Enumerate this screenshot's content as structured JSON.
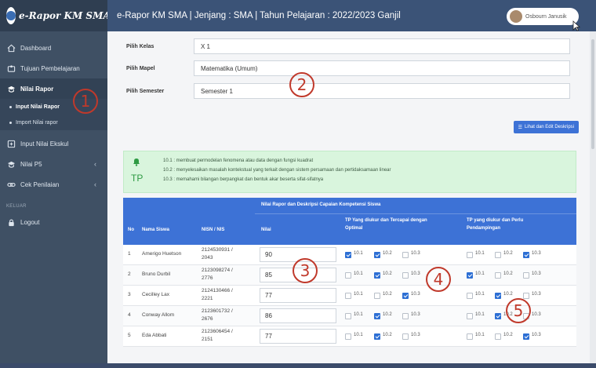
{
  "brand": {
    "name": "e-Rapor KM SMA",
    "collapse_icon": "double-chevron-left-icon"
  },
  "header": {
    "title": "e-Rapor KM SMA | Jenjang : SMA | Tahun Pelajaran : 2022/2023 Ganjil",
    "user_name": "Osbourn Janusik"
  },
  "sidebar": {
    "items": [
      {
        "label": "Dashboard",
        "icon": "home-icon"
      },
      {
        "label": "Tujuan Pembelajaran",
        "icon": "puzzle-icon"
      },
      {
        "label": "Nilai Rapor",
        "icon": "graduation-icon"
      },
      {
        "label": "Input Nilai Ekskul",
        "icon": "square-icon"
      },
      {
        "label": "Nilai P5",
        "icon": "graduation-icon"
      },
      {
        "label": "Cek Penilaian",
        "icon": "link-icon"
      },
      {
        "label": "Logout",
        "icon": "lock-icon"
      }
    ],
    "sub_items": [
      "Input Nilai Rapor",
      "Import Nilai rapor"
    ],
    "section_label": "KELUAR"
  },
  "form": {
    "kelas_label": "Pilih Kelas",
    "kelas_value": "X 1",
    "mapel_label": "Pilih Mapel",
    "mapel_value": "Matematika (Umum)",
    "semester_label": "Pilih Semester",
    "semester_value": "Semester 1"
  },
  "desc_button": "Lihat dan Edit Deskripsi",
  "tp": {
    "label": "TP",
    "lines": [
      "10.1 : membuat permodelan fenomena atau data dengan fungsi kuadrat",
      "10.2 : menyelesaikan masalah kontekstual yang terkait dengan sistem persamaan dan pertidaksamaan linear",
      "10.3 : memahami bilangan berpangkat dan bentuk akar beserta sifat-sifatnya"
    ]
  },
  "table": {
    "group_header": "Nilai Rapor dan Deskripsi Capaian Kompetensi Siswa",
    "headers": {
      "no": "No",
      "name": "Nama Siswa",
      "nisn": "NISN / NIS",
      "nilai": "Nilai",
      "tp_opt_1": "TP Yang diukur dan Tercapai dengan",
      "tp_opt_2": "Optimal",
      "tp_pend_1": "TP yang diukur dan Perlu",
      "tp_pend_2": "Pendampingan"
    },
    "tp_codes": [
      "10.1",
      "10.2",
      "10.3"
    ],
    "rows": [
      {
        "no": "1",
        "name": "Amerigo Huetson",
        "nisn_1": "2124530931 /",
        "nisn_2": "2043",
        "nilai": "90",
        "optimal": [
          true,
          true,
          false
        ],
        "pendampingan": [
          false,
          false,
          true
        ]
      },
      {
        "no": "2",
        "name": "Bruno Durbil",
        "nisn_1": "2123098274 /",
        "nisn_2": "2776",
        "nilai": "85",
        "optimal": [
          false,
          true,
          false
        ],
        "pendampingan": [
          true,
          false,
          false
        ]
      },
      {
        "no": "3",
        "name": "Cecilley Lax",
        "nisn_1": "2124130466 /",
        "nisn_2": "2221",
        "nilai": "77",
        "optimal": [
          false,
          false,
          true
        ],
        "pendampingan": [
          false,
          true,
          false
        ]
      },
      {
        "no": "4",
        "name": "Conway Allom",
        "nisn_1": "2123601732 /",
        "nisn_2": "2676",
        "nilai": "86",
        "optimal": [
          false,
          true,
          false
        ],
        "pendampingan": [
          false,
          true,
          false
        ]
      },
      {
        "no": "5",
        "name": "Eda Abbati",
        "nisn_1": "2123606454 /",
        "nisn_2": "2151",
        "nilai": "77",
        "optimal": [
          false,
          true,
          false
        ],
        "pendampingan": [
          false,
          false,
          true
        ]
      }
    ]
  },
  "callouts": [
    "1",
    "2",
    "3",
    "4",
    "5"
  ],
  "colors": {
    "sidebar": "#3f5064",
    "header": "#3b5377",
    "accent": "#3d72d6",
    "callout": "#c0392b",
    "tp_box": "#d9f5dd"
  }
}
